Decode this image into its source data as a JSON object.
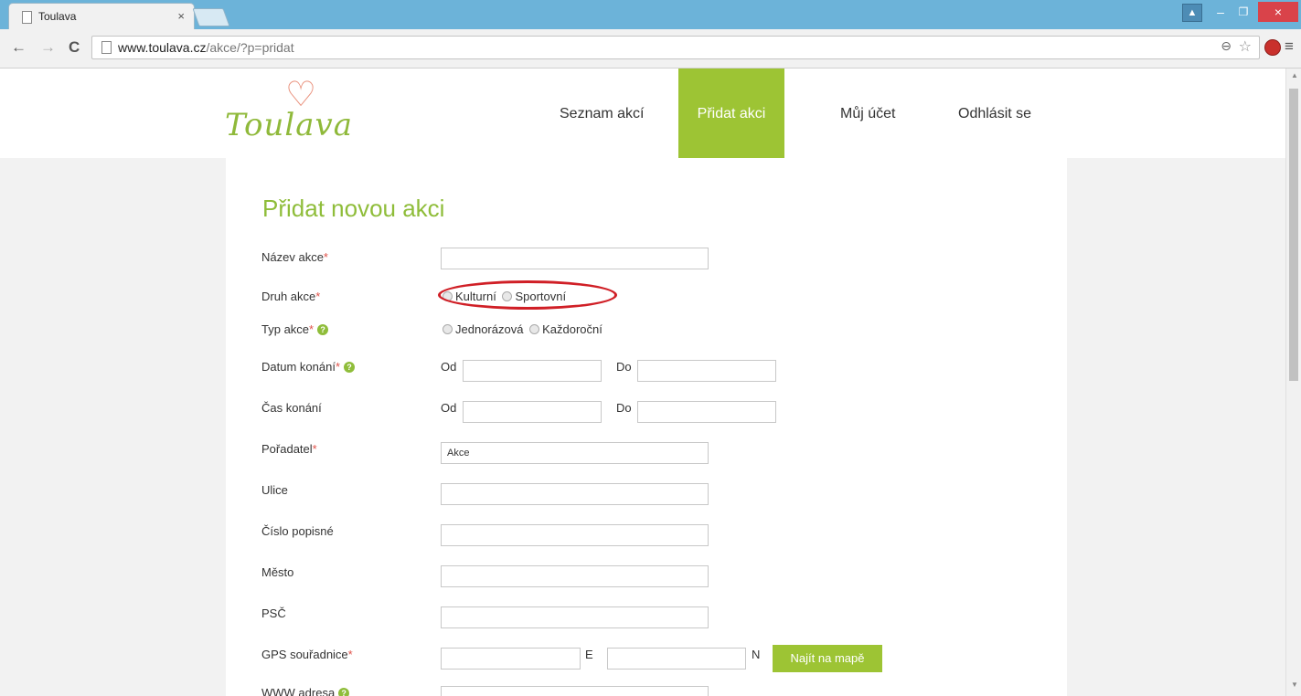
{
  "browser": {
    "tab_title": "Toulava",
    "tab_close": "×",
    "url_domain": "www.toulava.cz",
    "url_path": "/akce/?p=pridat",
    "zoom_icon": "⊖",
    "bookmark_icon": "☆",
    "back_icon": "←",
    "forward_icon": "→",
    "reload_icon": "C",
    "menu_icon": "≡",
    "min_icon": "–",
    "max_icon": "❐",
    "close_icon": "×"
  },
  "site": {
    "logo_text": "Toulava",
    "logo_heart": "♡",
    "nav": [
      {
        "label": "Seznam akcí",
        "active": false
      },
      {
        "label": "Přidat akci",
        "active": true
      },
      {
        "label": "Můj účet",
        "active": false
      },
      {
        "label": "Odhlásit se",
        "active": false
      }
    ],
    "accent_color": "#9dc434"
  },
  "form": {
    "title": "Přidat novou akci",
    "required_mark": "*",
    "help_icon": "?",
    "name_label": "Název akce",
    "kind_label": "Druh akce",
    "kind_options": [
      "Kulturní",
      "Sportovní"
    ],
    "type_label": "Typ akce",
    "type_options": [
      "Jednorázová",
      "Každoroční"
    ],
    "date_label": "Datum konání",
    "time_label": "Čas konání",
    "from_label": "Od",
    "to_label": "Do",
    "organizer_label": "Pořadatel",
    "organizer_value": "Akce",
    "street_label": "Ulice",
    "number_label": "Číslo popisné",
    "city_label": "Město",
    "zip_label": "PSČ",
    "gps_label": "GPS souřadnice",
    "gps_e": "E",
    "gps_n": "N",
    "map_button": "Najít na mapě",
    "www_label": "WWW adresa"
  }
}
